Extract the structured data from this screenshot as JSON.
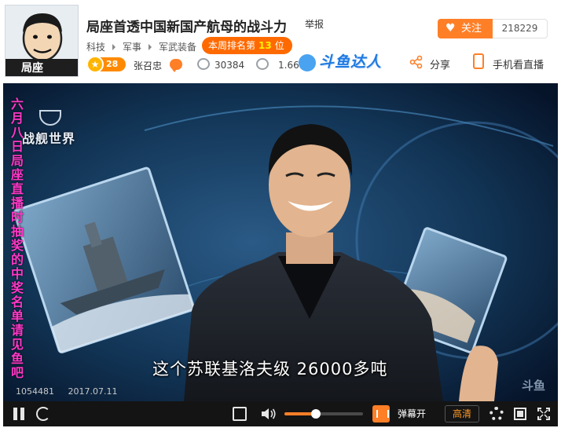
{
  "header": {
    "avatar_caption": "局座",
    "title": "局座首透中国新国产航母的战斗力",
    "report_label": "举报",
    "follow_label": "关注",
    "follow_count": "218229",
    "breadcrumb": [
      "科技",
      "军事",
      "军武装备"
    ],
    "rank": {
      "prefix": "本周排名第",
      "number": "13",
      "suffix": "位"
    },
    "level": "28",
    "anchor_name": "张召忠",
    "view_count": "30384",
    "fans_count": "1.66",
    "daren_logo": "斗鱼达人",
    "share_label": "分享",
    "phone_label": "手机看直播",
    "accent_color": "#ff7f27"
  },
  "video": {
    "game_logo": "战舰世界",
    "vertical_notice": "六月八日局座直播时抽奖的中奖名单请见鱼吧",
    "subtitle": "这个苏联基洛夫级 26000多吨",
    "room_id": "1054481",
    "date": "2017.07.11",
    "watermark": "斗鱼"
  },
  "controls": {
    "danmu_label": "弹幕开",
    "quality_label": "高清",
    "volume": 0.4
  },
  "icons": [
    "pause-icon",
    "refresh-icon",
    "edit-icon",
    "volume-icon",
    "danmu-toggle-icon",
    "gear-icon",
    "widescreen-icon",
    "fullscreen-icon",
    "share-icon",
    "phone-icon",
    "heart-icon",
    "view-icon",
    "chat-icon"
  ]
}
